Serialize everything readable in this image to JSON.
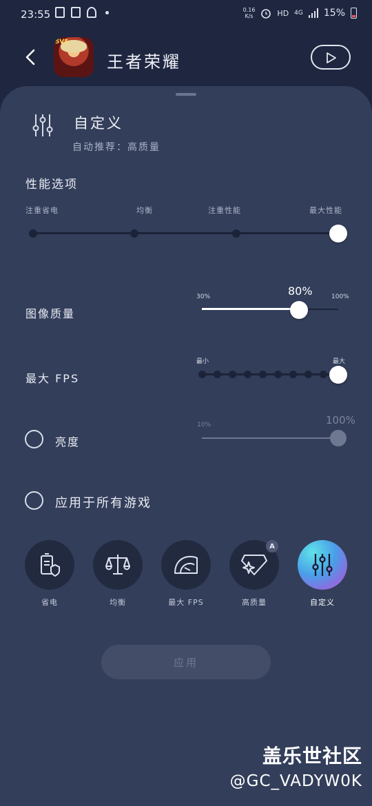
{
  "status_bar": {
    "time": "23:55",
    "net_speed_value": "0.16",
    "net_speed_unit": "K/s",
    "hd": "HD",
    "network": "4G",
    "battery": "15%"
  },
  "header": {
    "app_name": "王者荣耀",
    "icon_badge": "5V5"
  },
  "preset": {
    "title": "自定义",
    "subtitle": "自动推荐：高质量"
  },
  "performance": {
    "title": "性能选项",
    "options": [
      "注重省电",
      "均衡",
      "注重性能",
      "最大性能"
    ],
    "selected_index": 3
  },
  "image_quality": {
    "label": "图像质量",
    "min": "30%",
    "max": "100%",
    "value": "80%",
    "fraction": 0.71
  },
  "max_fps": {
    "label": "最大 FPS",
    "min": "最小",
    "max": "最大",
    "steps": 10,
    "selected_step": 9
  },
  "brightness": {
    "label": "亮度",
    "min": "10%",
    "value": "100%",
    "checked": false
  },
  "apply_all": {
    "label": "应用于所有游戏",
    "checked": false
  },
  "modes": [
    {
      "label": "省电",
      "icon": "battery-shield-icon"
    },
    {
      "label": "均衡",
      "icon": "scale-icon"
    },
    {
      "label": "最大 FPS",
      "icon": "speedometer-icon"
    },
    {
      "label": "高质量",
      "icon": "diamond-sparkle-icon",
      "badge": "A"
    },
    {
      "label": "自定义",
      "icon": "sliders-icon",
      "active": true
    }
  ],
  "apply_button": "应用",
  "watermark": {
    "line1": "盖乐世社区",
    "line2": "@GC_VADYW0K"
  },
  "colors": {
    "background": "#1e2640",
    "panel": "#333e5a",
    "track": "#1c2338",
    "knob": "#ffffff"
  }
}
